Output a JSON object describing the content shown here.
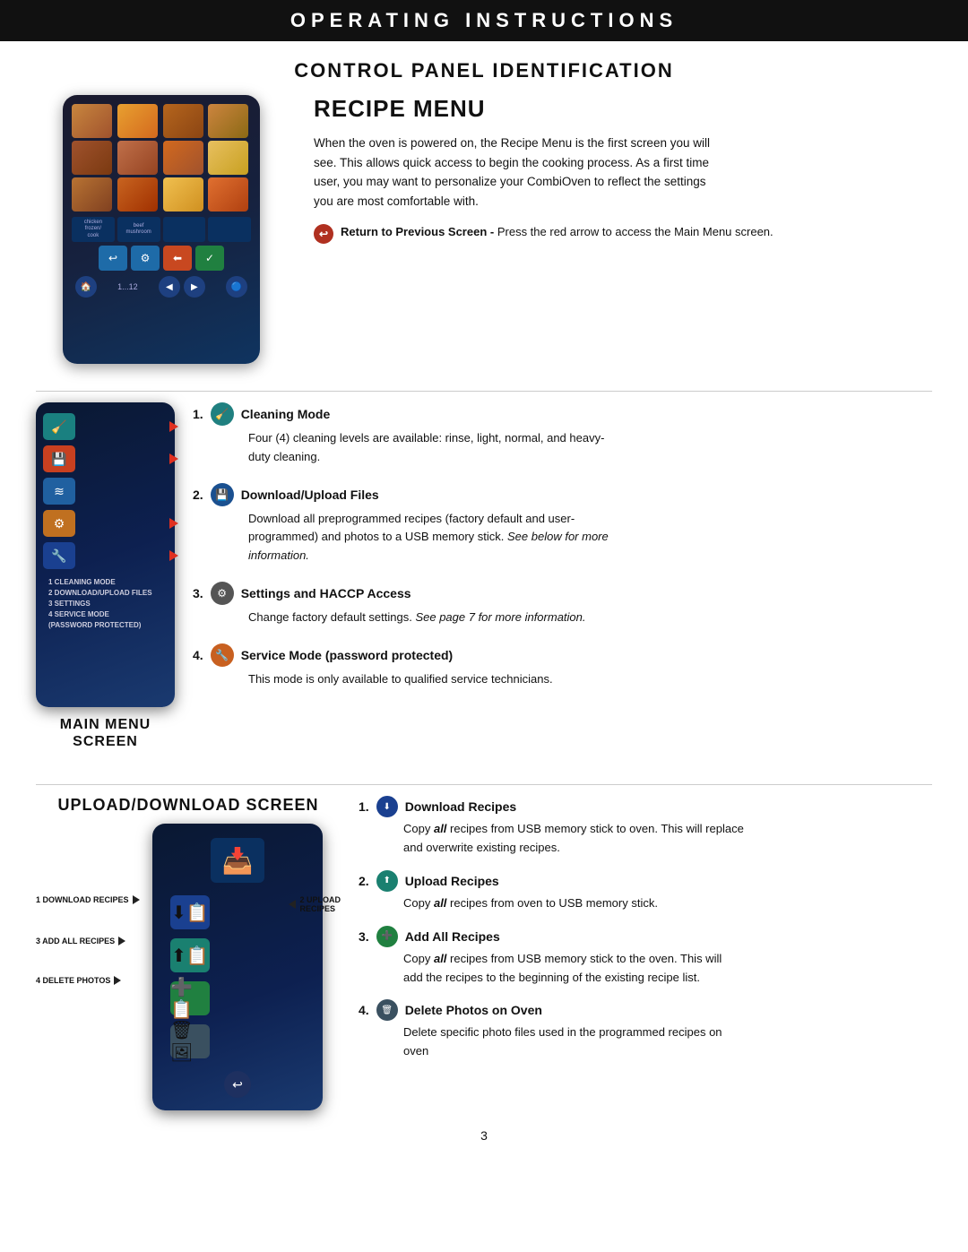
{
  "header": {
    "title": "OPERATING INSTRUCTIONS"
  },
  "page": {
    "section_title": "CONTROL PANEL IDENTIFICATION",
    "recipe_menu_title": "RECIPE MENU",
    "recipe_menu_text": "When the oven is powered on, the Recipe Menu is the first screen you will see. This allows quick access to begin the cooking process. As a first time user, you may want to personalize your CombiOven to reflect the settings you are most comfortable with.",
    "return_note_bold": "Return to Previous Screen -",
    "return_note_text": " Press the red arrow to access the Main Menu screen.",
    "main_menu_label": "MAIN MENU\nSCREEN",
    "main_menu_labels": [
      "1 CLEANING MODE",
      "2 DOWNLOAD/UPLOAD FILES",
      "3 SETTINGS",
      "4 SERVICE MODE",
      "(PASSWORD PROTECTED)"
    ],
    "numbered_items": [
      {
        "num": "1.",
        "title": "Cleaning Mode",
        "icon_color": "teal",
        "icon_symbol": "🧹",
        "text": "Four (4) cleaning levels are available: rinse, light, normal, and heavy-duty cleaning."
      },
      {
        "num": "2.",
        "title": "Download/Upload Files",
        "icon_color": "blue",
        "icon_symbol": "💾",
        "text": "Download all preprogrammed recipes (factory default and user-programmed) and photos to a USB memory stick. See below for more information."
      },
      {
        "num": "3.",
        "title": "Settings and HACCP Access",
        "icon_color": "gray",
        "icon_symbol": "⚙",
        "text": "Change factory default settings. See page 7 for more information.",
        "text_italic_part": "See page 7 for more information."
      },
      {
        "num": "4.",
        "title": "Service Mode (password protected)",
        "icon_color": "orange",
        "icon_symbol": "🔧",
        "text": "This mode is only available to qualified service technicians."
      }
    ],
    "upload_download_title": "UPLOAD/DOWNLOAD SCREEN",
    "ud_labels_left": [
      "1 DOWNLOAD RECIPES",
      "3 ADD ALL RECIPES",
      "4 DELETE PHOTOS"
    ],
    "ud_labels_right": [
      "2 UPLOAD",
      "RECIPES"
    ],
    "sub_numbered_items": [
      {
        "num": "1.",
        "title": "Download Recipes",
        "icon_color": "blue",
        "icon_symbol": "⬇",
        "text": "Copy all recipes from USB memory stick to oven. This will replace and overwrite existing recipes."
      },
      {
        "num": "2.",
        "title": "Upload Recipes",
        "icon_color": "teal",
        "icon_symbol": "⬆",
        "text": "Copy all recipes from oven to USB memory stick."
      },
      {
        "num": "3.",
        "title": "Add All Recipes",
        "icon_color": "green",
        "icon_symbol": "➕",
        "text": "Copy all recipes from USB memory stick to the oven. This will add the recipes to the beginning of the existing recipe list."
      },
      {
        "num": "4.",
        "title": "Delete Photos on Oven",
        "icon_color": "gray",
        "icon_symbol": "🗑",
        "text": "Delete specific photo files used in the programmed recipes on oven"
      }
    ],
    "page_number": "3"
  }
}
